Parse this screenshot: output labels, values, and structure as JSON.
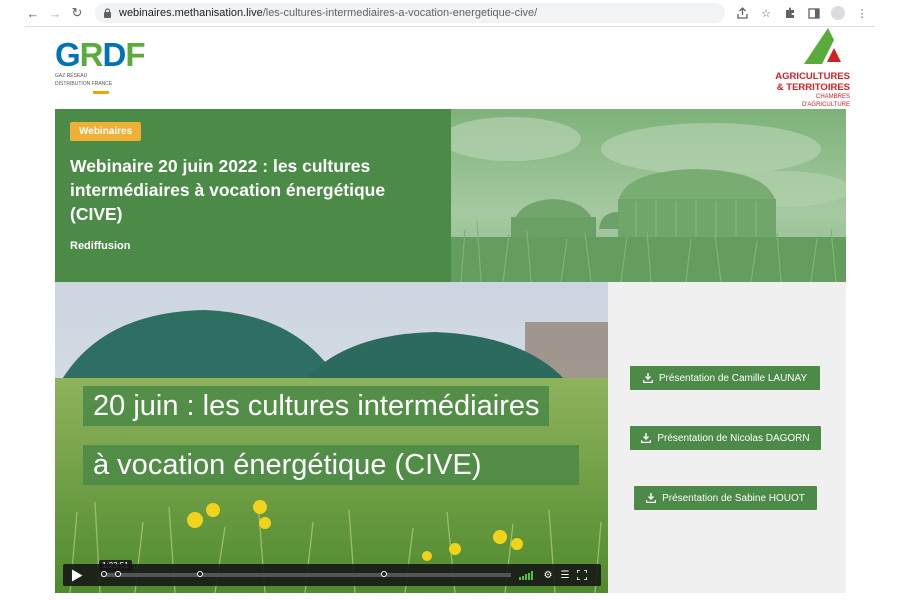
{
  "browser": {
    "url_host": "webinaires.methanisation.live",
    "url_path": "/les-cultures-intermediaires-a-vocation-energetique-cive/",
    "icons": [
      "back-icon",
      "forward-icon",
      "reload-icon",
      "lock-icon",
      "share-icon",
      "star-icon",
      "extensions-icon",
      "sidebar-icon",
      "profile-icon",
      "menu-icon"
    ]
  },
  "header": {
    "grdf_logo_text": "GRDF",
    "grdf_sub_line1": "GAZ RÉSEAU",
    "grdf_sub_line2": "DISTRIBUTION FRANCE",
    "agri_line1": "AGRICULTURES",
    "agri_line2": "& TERRITOIRES",
    "agri_line3": "CHAMBRES D'AGRICULTURE"
  },
  "hero": {
    "badge": "Webinaires",
    "title": "Webinaire 20 juin 2022 : les cultures intermédiaires à vocation énergétique (CIVE)",
    "subtitle": "Rediffusion"
  },
  "video": {
    "caption_line1": "20 juin : les cultures intermédiaires",
    "caption_line2": "à vocation énergétique (CIVE)",
    "time_tooltip": "1:23:51"
  },
  "downloads": [
    {
      "label": "Présentation de Camille LAUNAY"
    },
    {
      "label": "Présentation de Nicolas DAGORN"
    },
    {
      "label": "Présentation de Sabine HOUOT"
    }
  ],
  "colors": {
    "brand_green": "#4c8a47",
    "badge_orange": "#f0b036",
    "agri_red": "#d31f26"
  }
}
